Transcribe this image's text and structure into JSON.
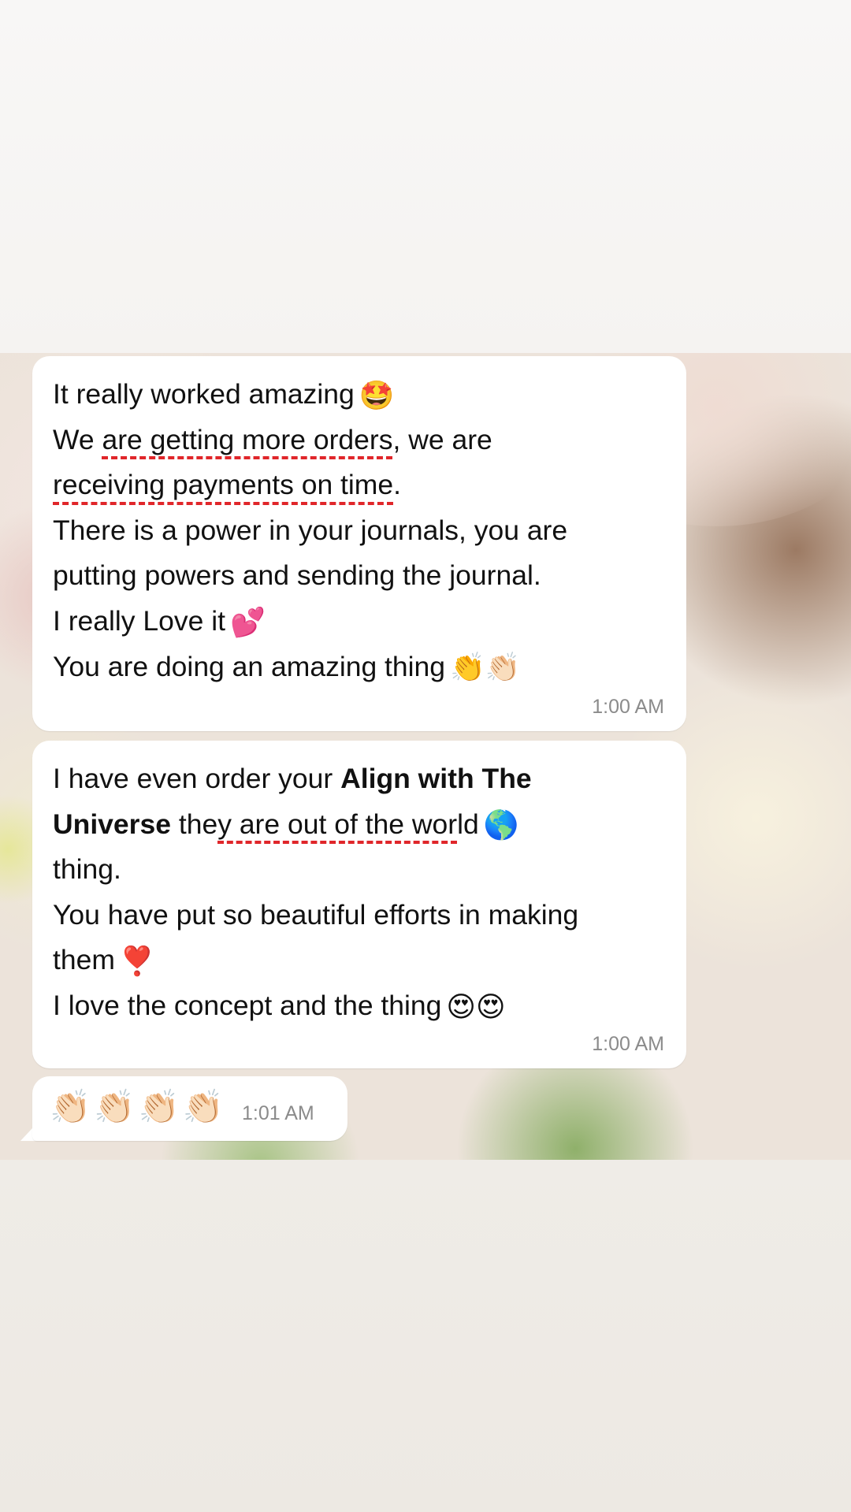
{
  "messages": [
    {
      "lines": [
        {
          "segments": [
            {
              "text": "It really worked amazing"
            }
          ],
          "emoji": "🤩"
        },
        {
          "segments": [
            {
              "text": "We "
            },
            {
              "text": "are getting more orders",
              "spell": true
            },
            {
              "text": ", we are"
            }
          ],
          "emoji": ""
        },
        {
          "segments": [
            {
              "text": "receiving payments on time",
              "spell": true
            },
            {
              "text": "."
            }
          ],
          "emoji": ""
        },
        {
          "segments": [
            {
              "text": "There is a power in your journals, you are"
            }
          ],
          "emoji": ""
        },
        {
          "segments": [
            {
              "text": "putting powers and sending the journal."
            }
          ],
          "emoji": ""
        },
        {
          "segments": [
            {
              "text": "I really Love it"
            }
          ],
          "emoji": "💕"
        },
        {
          "segments": [
            {
              "text": "You are doing an amazing thing"
            }
          ],
          "emoji": "👏👏🏻"
        }
      ],
      "time": "1:00 AM"
    },
    {
      "lines": [
        {
          "segments": [
            {
              "text": "I have even order your "
            },
            {
              "text": "Align with The",
              "bold": true
            }
          ],
          "emoji": ""
        },
        {
          "segments": [
            {
              "text": "Universe",
              "bold": true
            },
            {
              "text": " the"
            },
            {
              "text": "y are out of the wor",
              "spell": true
            },
            {
              "text": "ld"
            }
          ],
          "emoji": "🌎"
        },
        {
          "segments": [
            {
              "text": "thing."
            }
          ],
          "emoji": ""
        },
        {
          "segments": [
            {
              "text": "You have put so beautiful efforts in making"
            }
          ],
          "emoji": ""
        },
        {
          "segments": [
            {
              "text": "them"
            }
          ],
          "emoji": "❣️"
        },
        {
          "segments": [
            {
              "text": "I love the concept and the thing"
            }
          ],
          "emoji": "😍😍"
        }
      ],
      "time": "1:00 AM"
    },
    {
      "emoji_only": "👏🏻👏🏻👏🏻👏🏻",
      "time": "1:01 AM"
    }
  ],
  "colors": {
    "bubble": "#ffffff",
    "text": "#111111",
    "timestamp": "#8b8b8b",
    "spellcheck_underline": "#e0262a"
  }
}
